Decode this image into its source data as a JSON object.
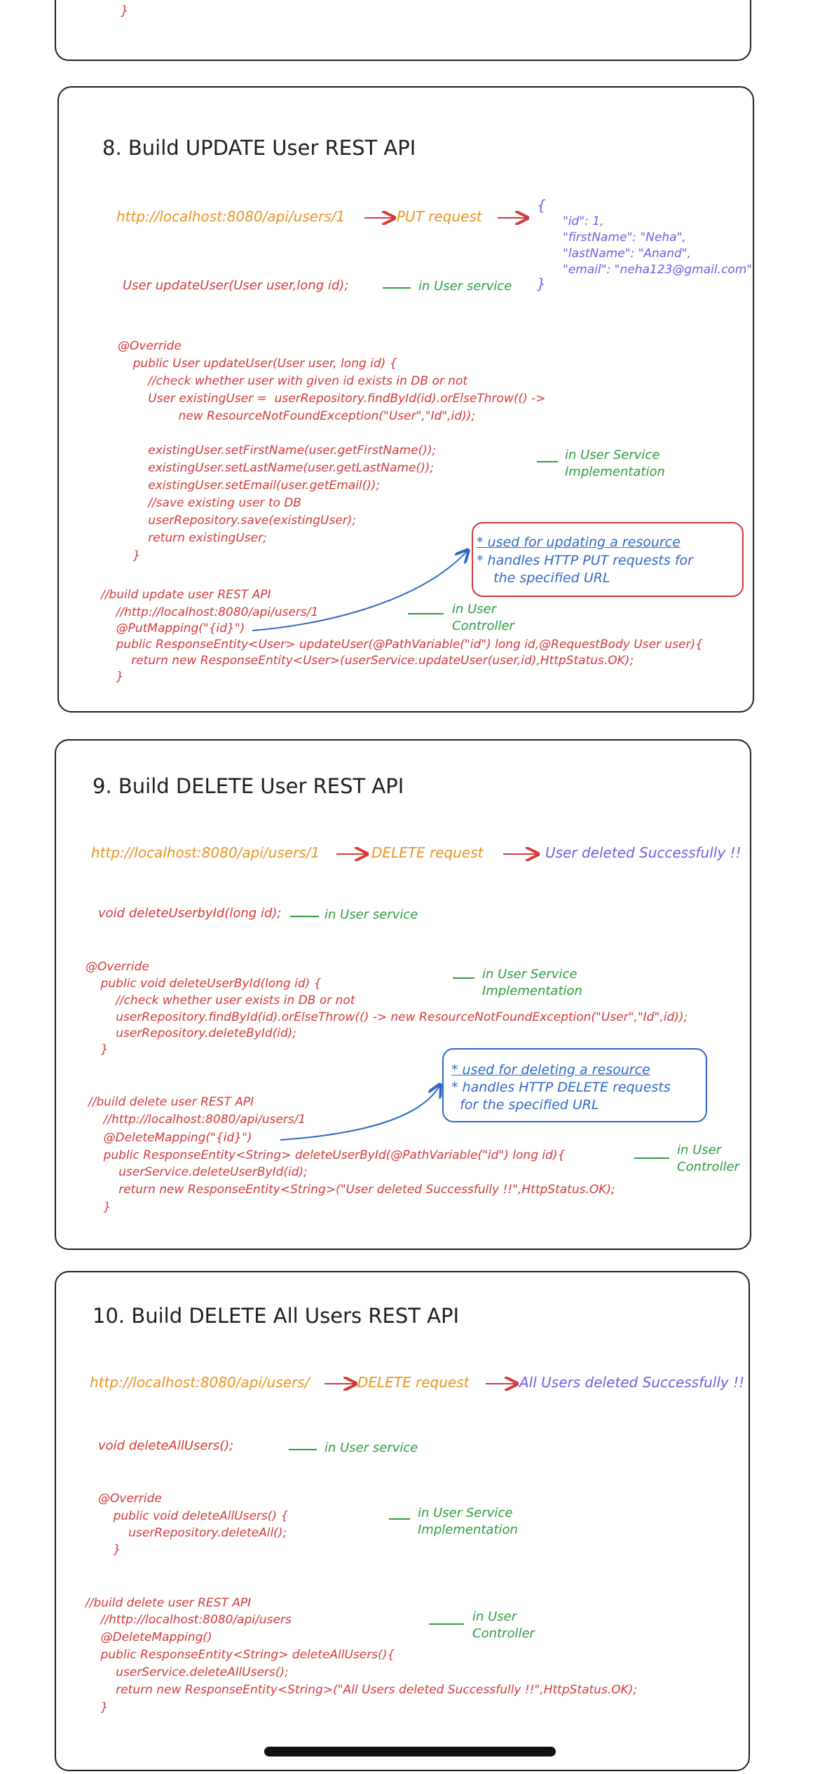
{
  "top_fragment": {
    "brace": "}"
  },
  "s8": {
    "title": "8. Build UPDATE User REST API",
    "url": "http://localhost:8080/api/users/1",
    "method": "PUT request",
    "json_open": "{",
    "json_lines": [
      "\"id\": 1,",
      "\"firstName\": \"Neha\",",
      "\"lastName\": \"Anand\",",
      "\"email\": \"neha123@gmail.com\""
    ],
    "json_close": "}",
    "service_sig": "User updateUser(User user,long id);",
    "service_note": "in User service",
    "impl_lines": [
      "@Override",
      "    public User updateUser(User user, long id) {",
      "        //check whether user with given id exists in DB or not",
      "        User existingUser =  userRepository.findById(id).orElseThrow(() ->",
      "                new ResourceNotFoundException(\"User\",\"Id\",id));",
      "",
      "        existingUser.setFirstName(user.getFirstName());",
      "        existingUser.setLastName(user.getLastName());",
      "        existingUser.setEmail(user.getEmail());",
      "        //save existing user to DB",
      "        userRepository.save(existingUser);",
      "        return existingUser;",
      "    }"
    ],
    "impl_note": [
      "in User Service",
      "Implementation"
    ],
    "callout": [
      "* used for updating a resource",
      "* handles HTTP PUT requests for",
      "    the specified URL"
    ],
    "controller_lines": [
      "//build update user REST API",
      "    //http://localhost:8080/api/users/1",
      "    @PutMapping(\"{id}\")",
      "    public ResponseEntity<User> updateUser(@PathVariable(\"id\") long id,@RequestBody User user){",
      "        return new ResponseEntity<User>(userService.updateUser(user,id),HttpStatus.OK);",
      "    }"
    ],
    "controller_note": [
      "in User",
      "Controller"
    ]
  },
  "s9": {
    "title": "9. Build DELETE User REST API",
    "url": "http://localhost:8080/api/users/1",
    "method": "DELETE request",
    "result": "User deleted Successfully !!",
    "service_sig": "void deleteUserbyId(long id);",
    "service_note": "in User service",
    "impl_lines": [
      "@Override",
      "    public void deleteUserById(long id) {",
      "        //check whether user exists in DB or not",
      "        userRepository.findById(id).orElseThrow(() -> new ResourceNotFoundException(\"User\",\"Id\",id));",
      "        userRepository.deleteById(id);",
      "    }"
    ],
    "impl_note": [
      "in User Service",
      "Implementation"
    ],
    "callout": [
      "* used for deleting a resource",
      "* handles HTTP DELETE requests",
      "  for the specified URL"
    ],
    "controller_lines": [
      "//build delete user REST API",
      "    //http://localhost:8080/api/users/1",
      "    @DeleteMapping(\"{id}\")",
      "    public ResponseEntity<String> deleteUserById(@PathVariable(\"id\") long id){",
      "        userService.deleteUserById(id);",
      "        return new ResponseEntity<String>(\"User deleted Successfully !!\",HttpStatus.OK);",
      "    }"
    ],
    "controller_note": [
      "in User",
      "Controller"
    ]
  },
  "s10": {
    "title": "10. Build DELETE All Users REST API",
    "url": "http://localhost:8080/api/users/",
    "method": "DELETE request",
    "result": "All Users deleted Successfully !!",
    "service_sig": "void deleteAllUsers();",
    "service_note": "in User service",
    "impl_lines": [
      "@Override",
      "    public void deleteAllUsers() {",
      "        userRepository.deleteAll();",
      "    }"
    ],
    "impl_note": [
      "in User Service",
      "Implementation"
    ],
    "controller_lines": [
      "//build delete user REST API",
      "    //http://localhost:8080/api/users",
      "    @DeleteMapping()",
      "    public ResponseEntity<String> deleteAllUsers(){",
      "        userService.deleteAllUsers();",
      "        return new ResponseEntity<String>(\"All Users deleted Successfully !!\",HttpStatus.OK);",
      "    }"
    ],
    "controller_note": [
      "in User",
      "Controller"
    ]
  }
}
